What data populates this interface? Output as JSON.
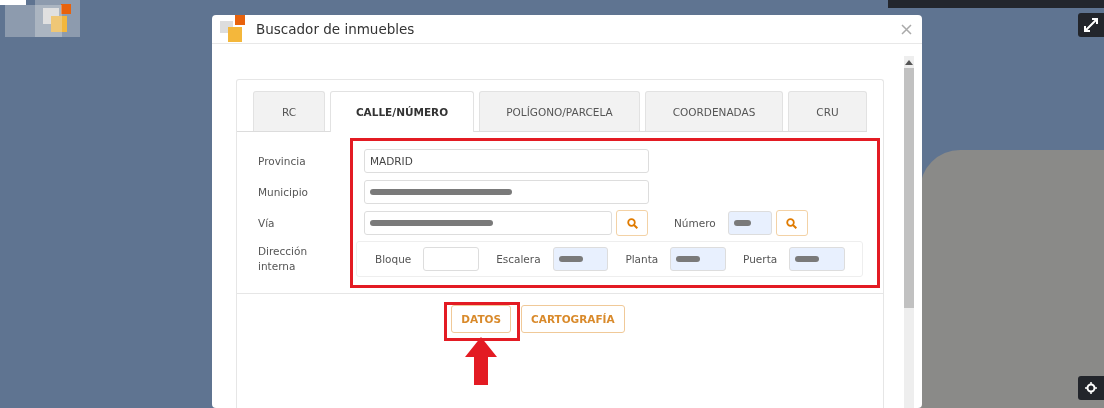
{
  "dialog": {
    "title": "Buscador de inmuebles"
  },
  "tabs": [
    {
      "label": "RC",
      "selected": false
    },
    {
      "label": "CALLE/NÚMERO",
      "selected": true
    },
    {
      "label": "POLÍGONO/PARCELA",
      "selected": false
    },
    {
      "label": "COORDENADAS",
      "selected": false
    },
    {
      "label": "CRU",
      "selected": false
    }
  ],
  "form_highlighted": true,
  "address_rows": [
    {
      "label": "Provincia",
      "input": {
        "value": "MADRID",
        "redacted": false,
        "autofilled": false
      },
      "search": false
    },
    {
      "label": "Municipio",
      "input": {
        "redacted": true,
        "autofilled": false
      },
      "search": false
    },
    {
      "label": "Vía",
      "input": {
        "redacted": true,
        "autofilled": false
      },
      "search": true,
      "extra": {
        "label": "Número",
        "input": {
          "redacted": true,
          "autofilled": true
        },
        "search": true
      }
    }
  ],
  "internal_address": {
    "label": "Dirección interna",
    "fields": [
      {
        "label": "Bloque",
        "redacted": false,
        "autofilled": false
      },
      {
        "label": "Escalera",
        "redacted": true,
        "autofilled": true
      },
      {
        "label": "Planta",
        "redacted": true,
        "autofilled": true
      },
      {
        "label": "Puerta",
        "redacted": true,
        "autofilled": true
      }
    ]
  },
  "actions": [
    {
      "label": "DATOS",
      "highlighted": true
    },
    {
      "label": "CARTOGRAFÍA",
      "highlighted": false
    }
  ]
}
